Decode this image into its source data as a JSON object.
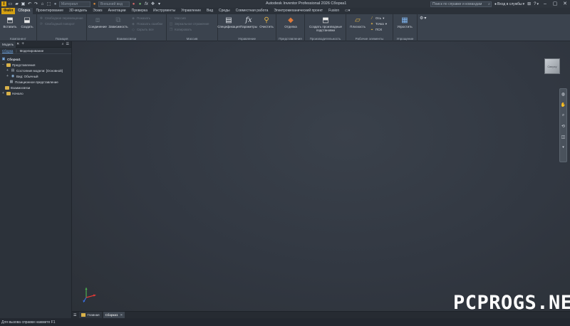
{
  "titlebar": {
    "app_title": "Autodesk Inventor Professional 2026  Сборка1",
    "material": "Материал",
    "appearance": "Внешний вид",
    "search_placeholder": "Поиск по справке и командам",
    "signin": "Вход в службы",
    "help": "?"
  },
  "tabs": [
    "Файл",
    "Сборка",
    "Проектирование",
    "3D-модель",
    "Эскиз",
    "Аннотации",
    "Проверка",
    "Инструменты",
    "Управление",
    "Вид",
    "Среды",
    "Совместная работа",
    "Электромеханический проект",
    "Fusion"
  ],
  "ribbon": {
    "groups": {
      "components": "Компонент",
      "position": "Позиция",
      "relationships": "Взаимосвязи",
      "pattern": "Массив",
      "manage": "Управление",
      "representation": "Представления",
      "productivity": "Производительность",
      "work_features": "Рабочие элементы",
      "simplification": "Упрощение"
    },
    "insert": "Вставить",
    "create": "Создать",
    "free_move": "Свободное перемещение",
    "free_rotate": "Свободный поворот",
    "constrain": "Соединение",
    "assemble": "Зависимость",
    "show": "Показать",
    "show_sick": "Показать ошибки",
    "hide_all": "Скрыть все",
    "pattern": "Массив",
    "mirror": "Зеркальное отражение",
    "copy": "Копировать",
    "bom": "Спецификация",
    "parameters": "Параметры",
    "purge": "Очистить",
    "shaded": "Отделка",
    "create_substitutes": "Создать производные подстановки",
    "plane": "Плоскость",
    "axis": "Ось",
    "point": "Точка",
    "ucs": "ПСК",
    "simplify": "Упростить"
  },
  "browser": {
    "tab": "Модель",
    "add": "+",
    "sub_tabs": [
      "Сборка",
      "Моделирование"
    ],
    "tree": [
      {
        "label": "Сборка1",
        "level": 0,
        "toggle": "",
        "kind": "asm"
      },
      {
        "label": "Представления",
        "level": 1,
        "toggle": "−",
        "kind": "folder"
      },
      {
        "label": "Состояния модели: [Основной]",
        "level": 2,
        "toggle": "+",
        "kind": "state"
      },
      {
        "label": "Вид: Обычный",
        "level": 2,
        "toggle": "+",
        "kind": "view"
      },
      {
        "label": "Позиционное представление",
        "level": 2,
        "toggle": "",
        "kind": "pos"
      },
      {
        "label": "Взаимосвязи",
        "level": 1,
        "toggle": "",
        "kind": "folder"
      },
      {
        "label": "Начало",
        "level": 1,
        "toggle": "+",
        "kind": "folder"
      }
    ]
  },
  "viewcube": "Сверху",
  "doc_tabs": [
    "Главная",
    "Сборка1"
  ],
  "status": "Для вызова справки нажмите F1",
  "watermark": "PCPROGS.NET"
}
